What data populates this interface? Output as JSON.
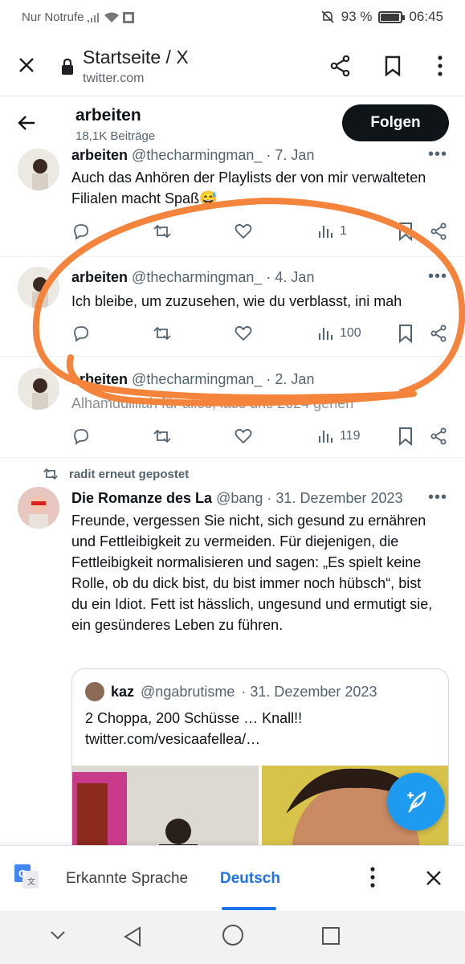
{
  "status_bar": {
    "carrier": "Nur Notrufe",
    "battery": "93 %",
    "time": "06:45"
  },
  "browser": {
    "title": "Startseite / X",
    "url": "twitter.com"
  },
  "header": {
    "name": "arbeiten",
    "post_count": "18,1K Beiträge",
    "follow_label": "Folgen"
  },
  "tweets": [
    {
      "name": "arbeiten",
      "handle": "@thecharmingman_",
      "date": "· 7. Jan",
      "text": "Auch das Anhören der Playlists der von mir verwalteten Filialen macht Spaß😅",
      "views": "1​"
    },
    {
      "name": "arbeiten",
      "handle": "@thecharmingman_",
      "date": "· 4. Jan",
      "text": "Ich bleibe, um zuzusehen, wie du verblasst, ini mah",
      "views": "100"
    },
    {
      "name": "arbeiten",
      "handle": "@thecharmingman_",
      "date": "· 2. Jan",
      "text": "Alhamdulillah für alles, lass uns 2024 gehen",
      "views": "119"
    }
  ],
  "retweet": {
    "note": "radit erneut gepostet",
    "name": "Die Romanze des La",
    "handle": "@bang",
    "date": "· 31. Dezember 2023",
    "text": "Freunde, vergessen Sie nicht, sich gesund zu ernähren und Fettleibigkeit zu vermeiden. Für diejenigen, die Fettleibigkeit normalisieren und sagen: „Es spielt keine Rolle, ob du dick bist, du bist immer noch hübsch“, bist du ein Idiot. Fett ist hässlich, ungesund und ermutigt sie, ein gesünderes Leben zu führen.",
    "quote": {
      "name": "kaz",
      "handle": "@ngabrutisme",
      "date": "· 31. Dezember 2023",
      "text_line1": "2 Choppa, 200 Schüsse … Knall!!",
      "text_line2": "twitter.com/vesicaafellea/…"
    }
  },
  "translate_bar": {
    "detected_label": "Erkannte Sprache",
    "target_label": "Deutsch"
  },
  "colors": {
    "accent": "#1d9bf0",
    "scribble": "#f4843b",
    "translate_blue": "#1a73e8"
  }
}
